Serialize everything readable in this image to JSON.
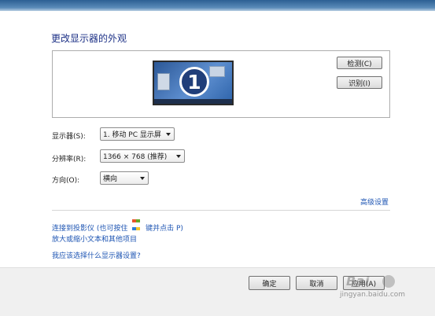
{
  "window": {
    "title": "更改显示器的外观"
  },
  "preview": {
    "monitor_number": "1"
  },
  "buttons": {
    "detect": "检测(C)",
    "identify": "识别(I)",
    "ok": "确定",
    "cancel": "取消",
    "apply": "应用(A)"
  },
  "fields": {
    "display": {
      "label": "显示器(S):",
      "value": "1. 移动 PC 显示屏"
    },
    "resolution": {
      "label": "分辨率(R):",
      "value": "1366 × 768 (推荐)"
    },
    "orientation": {
      "label": "方向(O):",
      "value": "横向"
    }
  },
  "links": {
    "advanced": "高级设置",
    "projector_prefix": "连接到投影仪 (也可按住",
    "projector_suffix": "键并点击 P)",
    "text_size": "放大或缩小文本和其他项目",
    "which_settings": "我应该选择什么显示器设置?"
  },
  "icons": {
    "windows_key": "windows-logo-icon"
  },
  "watermark": {
    "logo": "Bai",
    "site": "jingyan.baidu.com"
  }
}
